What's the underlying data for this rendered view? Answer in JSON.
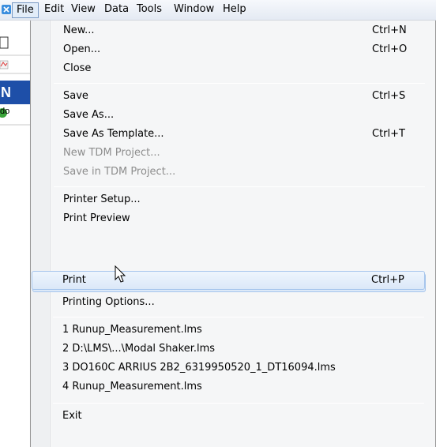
{
  "menubar": {
    "app_icon": "app-x-icon",
    "items": [
      {
        "label": "File"
      },
      {
        "label": "Edit"
      },
      {
        "label": "View"
      },
      {
        "label": "Data"
      },
      {
        "label": "Tools"
      },
      {
        "label": "Window"
      },
      {
        "label": "Help"
      }
    ]
  },
  "file_menu": {
    "items": [
      {
        "label": "New...",
        "shortcut": "Ctrl+N"
      },
      {
        "label": "Open...",
        "shortcut": "Ctrl+O"
      },
      {
        "label": "Close",
        "shortcut": ""
      },
      {
        "label": "Save",
        "shortcut": "Ctrl+S"
      },
      {
        "label": "Save As...",
        "shortcut": ""
      },
      {
        "label": "Save As Template...",
        "shortcut": "Ctrl+T"
      },
      {
        "label": "New TDM Project...",
        "shortcut": "",
        "disabled": true
      },
      {
        "label": "Save in TDM Project...",
        "shortcut": "",
        "disabled": true
      },
      {
        "label": "Printer Setup...",
        "shortcut": ""
      },
      {
        "label": "Print Preview",
        "shortcut": ""
      },
      {
        "label": "Print",
        "shortcut": "Ctrl+P",
        "hovered": true
      },
      {
        "label": "Printing Options...",
        "shortcut": ""
      },
      {
        "label": "1 Runup_Measurement.lms",
        "shortcut": ""
      },
      {
        "label": "2 D:\\LMS\\...\\Modal Shaker.lms",
        "shortcut": ""
      },
      {
        "label": "3 DO160C ARRIUS 2B2_6319950520_1_DT16094.lms",
        "shortcut": ""
      },
      {
        "label": "4 Runup_Measurement.lms",
        "shortcut": ""
      },
      {
        "label": "Exit",
        "shortcut": ""
      }
    ]
  },
  "background": {
    "left_fragment_text": "do"
  },
  "colors": {
    "menubar_bg": "#e4eaf3",
    "dropdown_bg": "#f5f6f7",
    "hover_border": "#a6c5ec",
    "disabled_text": "#8d8d8d",
    "toolbar_blue": "#1e4fa8"
  }
}
